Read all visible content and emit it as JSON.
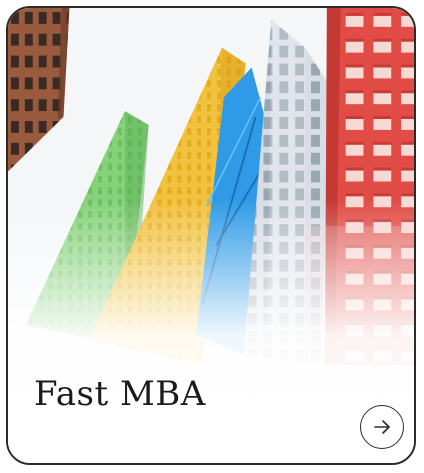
{
  "card": {
    "title": "Fast MBA",
    "image": "buildings-photo",
    "open_icon": "arrow-right-icon"
  },
  "colors": {
    "border": "#2b2b2b",
    "text": "#1b1b1b",
    "green_facade": "#7fd07a",
    "yellow_facade": "#f3c84a",
    "blue_glass": "#2f9be8",
    "red_facade": "#e8504a",
    "brick": "#9a5a3e"
  }
}
